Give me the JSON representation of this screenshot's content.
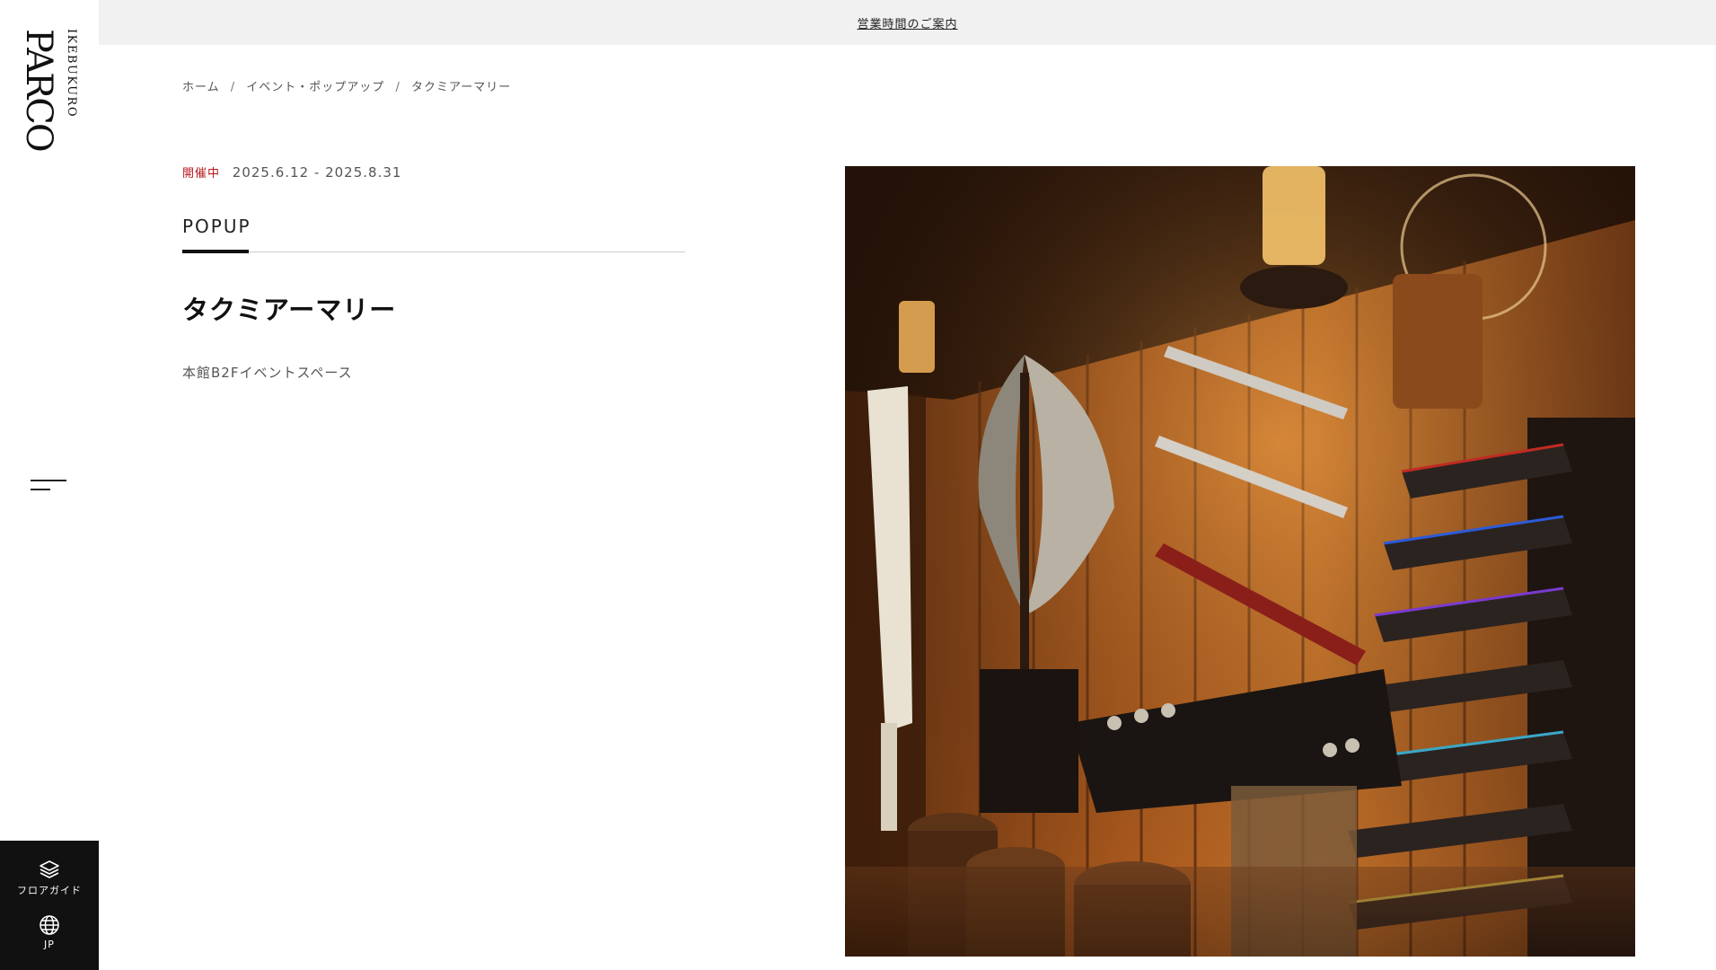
{
  "brand": {
    "logo_top": "IKEBUKURO",
    "logo_main": "PARCO",
    "logo_icon": "parco-logo"
  },
  "notice": {
    "link_label": "営業時間のご案内"
  },
  "breadcrumb": {
    "items": [
      "ホーム",
      "イベント・ポップアップ",
      "タクミアーマリー"
    ],
    "separator": "/"
  },
  "event": {
    "status": "開催中",
    "dates": "2025.6.12 - 2025.8.31",
    "category": "POPUP",
    "title": "タクミアーマリー",
    "location": "本館B2Fイベントスペース"
  },
  "sidebar": {
    "menu_icon": "hamburger-icon",
    "floor_guide_label": "フロアガイド",
    "floor_guide_icon": "layers-icon",
    "language_label": "JP",
    "language_icon": "globe-icon"
  },
  "hero_image": {
    "subject": "weapon-display-photo"
  },
  "colors": {
    "status_red": "#b8161d",
    "notice_bg": "#f1f1f1",
    "bottom_box_bg": "#111111"
  }
}
